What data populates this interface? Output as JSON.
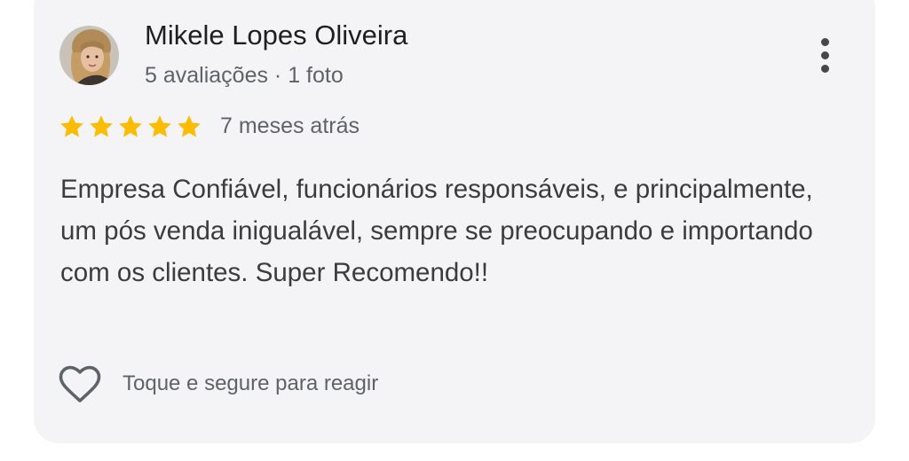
{
  "review": {
    "reviewer_name": "Mikele Lopes Oliveira",
    "reviewer_meta": "5 avaliações · 1 foto",
    "rating": 5,
    "rating_max": 5,
    "time_ago": "7 meses atrás",
    "text": "Empresa Confiável, funcionários responsáveis, e principalmente, um pós venda inigualável, sempre se preocupando e importando com os clientes. Super Recomendo!!",
    "react_hint": "Toque e segure para reagir"
  },
  "icons": {
    "more": "more-vertical-icon",
    "star": "star-icon",
    "heart": "heart-outline-icon"
  },
  "colors": {
    "card_background": "#f4f4f6",
    "star": "#fbbc04",
    "primary_text": "#1f1f1f",
    "secondary_text": "#5f6368"
  }
}
